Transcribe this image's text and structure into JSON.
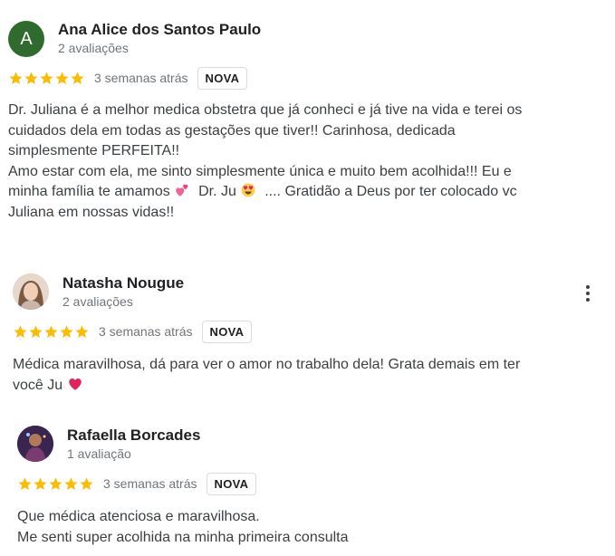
{
  "colors": {
    "star": "#fbbc04",
    "avatar_a": "#2e6b2d",
    "heart": "#e0245e"
  },
  "reviews": [
    {
      "author": "Ana Alice dos Santos Paulo",
      "meta": "2 avaliações",
      "avatar_letter": "A",
      "rating": 5,
      "date": "3 semanas atrás",
      "badge": "NOVA",
      "lines": [
        "Dr. Juliana é a melhor medica obstetra que já conheci e já tive na vida e terei os",
        "cuidados dela em todas as gestações que tiver!! Carinhosa, dedicada",
        "simplesmente PERFEITA!!",
        "Amo estar com ela, me sinto simplesmente única e muito bem acolhida!!! Eu e",
        "minha família te amamos",
        "Dr. Ju",
        ".... Gratidão a Deus por ter colocado vc",
        "Juliana em nossas vidas!!"
      ]
    },
    {
      "author": "Natasha Nougue",
      "meta": "2 avaliações",
      "rating": 5,
      "date": "3 semanas atrás",
      "badge": "NOVA",
      "lines": [
        "Médica maravilhosa, dá para ver o amor no trabalho dela! Grata demais em ter",
        "você Ju"
      ]
    },
    {
      "author": "Rafaella Borcades",
      "meta": "1 avaliação",
      "rating": 5,
      "date": "3 semanas atrás",
      "badge": "NOVA",
      "lines": [
        "Que médica atenciosa e maravilhosa.",
        "Me senti super acolhida na minha primeira consulta"
      ]
    }
  ],
  "icons": {
    "star": "star-icon",
    "more": "more-vert-icon",
    "two_hearts": "two-hearts-emoji",
    "heart_eyes": "heart-eyes-emoji",
    "red_heart": "red-heart-emoji"
  }
}
